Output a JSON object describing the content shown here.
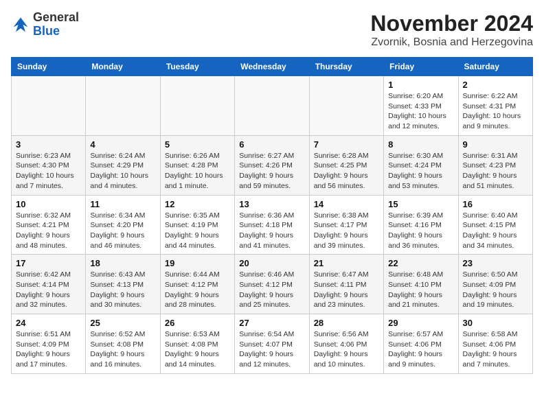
{
  "header": {
    "logo_general": "General",
    "logo_blue": "Blue",
    "month_year": "November 2024",
    "location": "Zvornik, Bosnia and Herzegovina"
  },
  "weekdays": [
    "Sunday",
    "Monday",
    "Tuesday",
    "Wednesday",
    "Thursday",
    "Friday",
    "Saturday"
  ],
  "weeks": [
    [
      {
        "day": "",
        "info": ""
      },
      {
        "day": "",
        "info": ""
      },
      {
        "day": "",
        "info": ""
      },
      {
        "day": "",
        "info": ""
      },
      {
        "day": "",
        "info": ""
      },
      {
        "day": "1",
        "info": "Sunrise: 6:20 AM\nSunset: 4:33 PM\nDaylight: 10 hours\nand 12 minutes."
      },
      {
        "day": "2",
        "info": "Sunrise: 6:22 AM\nSunset: 4:31 PM\nDaylight: 10 hours\nand 9 minutes."
      }
    ],
    [
      {
        "day": "3",
        "info": "Sunrise: 6:23 AM\nSunset: 4:30 PM\nDaylight: 10 hours\nand 7 minutes."
      },
      {
        "day": "4",
        "info": "Sunrise: 6:24 AM\nSunset: 4:29 PM\nDaylight: 10 hours\nand 4 minutes."
      },
      {
        "day": "5",
        "info": "Sunrise: 6:26 AM\nSunset: 4:28 PM\nDaylight: 10 hours\nand 1 minute."
      },
      {
        "day": "6",
        "info": "Sunrise: 6:27 AM\nSunset: 4:26 PM\nDaylight: 9 hours\nand 59 minutes."
      },
      {
        "day": "7",
        "info": "Sunrise: 6:28 AM\nSunset: 4:25 PM\nDaylight: 9 hours\nand 56 minutes."
      },
      {
        "day": "8",
        "info": "Sunrise: 6:30 AM\nSunset: 4:24 PM\nDaylight: 9 hours\nand 53 minutes."
      },
      {
        "day": "9",
        "info": "Sunrise: 6:31 AM\nSunset: 4:23 PM\nDaylight: 9 hours\nand 51 minutes."
      }
    ],
    [
      {
        "day": "10",
        "info": "Sunrise: 6:32 AM\nSunset: 4:21 PM\nDaylight: 9 hours\nand 48 minutes."
      },
      {
        "day": "11",
        "info": "Sunrise: 6:34 AM\nSunset: 4:20 PM\nDaylight: 9 hours\nand 46 minutes."
      },
      {
        "day": "12",
        "info": "Sunrise: 6:35 AM\nSunset: 4:19 PM\nDaylight: 9 hours\nand 44 minutes."
      },
      {
        "day": "13",
        "info": "Sunrise: 6:36 AM\nSunset: 4:18 PM\nDaylight: 9 hours\nand 41 minutes."
      },
      {
        "day": "14",
        "info": "Sunrise: 6:38 AM\nSunset: 4:17 PM\nDaylight: 9 hours\nand 39 minutes."
      },
      {
        "day": "15",
        "info": "Sunrise: 6:39 AM\nSunset: 4:16 PM\nDaylight: 9 hours\nand 36 minutes."
      },
      {
        "day": "16",
        "info": "Sunrise: 6:40 AM\nSunset: 4:15 PM\nDaylight: 9 hours\nand 34 minutes."
      }
    ],
    [
      {
        "day": "17",
        "info": "Sunrise: 6:42 AM\nSunset: 4:14 PM\nDaylight: 9 hours\nand 32 minutes."
      },
      {
        "day": "18",
        "info": "Sunrise: 6:43 AM\nSunset: 4:13 PM\nDaylight: 9 hours\nand 30 minutes."
      },
      {
        "day": "19",
        "info": "Sunrise: 6:44 AM\nSunset: 4:12 PM\nDaylight: 9 hours\nand 28 minutes."
      },
      {
        "day": "20",
        "info": "Sunrise: 6:46 AM\nSunset: 4:12 PM\nDaylight: 9 hours\nand 25 minutes."
      },
      {
        "day": "21",
        "info": "Sunrise: 6:47 AM\nSunset: 4:11 PM\nDaylight: 9 hours\nand 23 minutes."
      },
      {
        "day": "22",
        "info": "Sunrise: 6:48 AM\nSunset: 4:10 PM\nDaylight: 9 hours\nand 21 minutes."
      },
      {
        "day": "23",
        "info": "Sunrise: 6:50 AM\nSunset: 4:09 PM\nDaylight: 9 hours\nand 19 minutes."
      }
    ],
    [
      {
        "day": "24",
        "info": "Sunrise: 6:51 AM\nSunset: 4:09 PM\nDaylight: 9 hours\nand 17 minutes."
      },
      {
        "day": "25",
        "info": "Sunrise: 6:52 AM\nSunset: 4:08 PM\nDaylight: 9 hours\nand 16 minutes."
      },
      {
        "day": "26",
        "info": "Sunrise: 6:53 AM\nSunset: 4:08 PM\nDaylight: 9 hours\nand 14 minutes."
      },
      {
        "day": "27",
        "info": "Sunrise: 6:54 AM\nSunset: 4:07 PM\nDaylight: 9 hours\nand 12 minutes."
      },
      {
        "day": "28",
        "info": "Sunrise: 6:56 AM\nSunset: 4:06 PM\nDaylight: 9 hours\nand 10 minutes."
      },
      {
        "day": "29",
        "info": "Sunrise: 6:57 AM\nSunset: 4:06 PM\nDaylight: 9 hours\nand 9 minutes."
      },
      {
        "day": "30",
        "info": "Sunrise: 6:58 AM\nSunset: 4:06 PM\nDaylight: 9 hours\nand 7 minutes."
      }
    ]
  ]
}
